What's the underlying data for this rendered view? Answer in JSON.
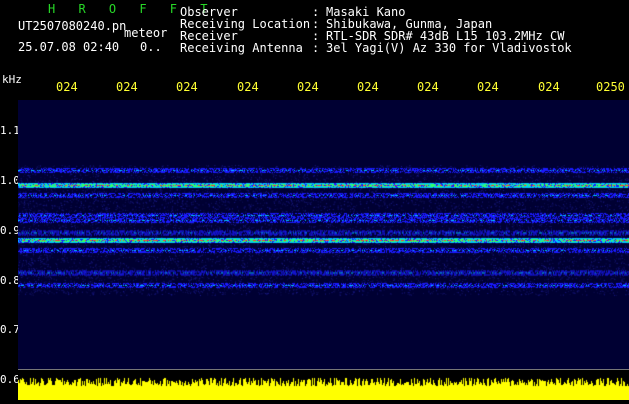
{
  "header": {
    "brand": "H R O F F T",
    "filename": "UT2507080240.pn",
    "file_tag": "meteor",
    "datetime": "25.07.08 02:40",
    "datetime_suffix": "0.."
  },
  "info": [
    {
      "label": "Observer",
      "value": "Masaki Kano"
    },
    {
      "label": "Receiving Location",
      "value": "Shibukawa, Gunma, Japan"
    },
    {
      "label": "Receiver",
      "value": "RTL-SDR SDR# 43dB L15 103.2MHz CW"
    },
    {
      "label": "Receiving Antenna",
      "value": "3el Yagi(V) Az 330 for Vladivostok"
    }
  ],
  "separator": ":",
  "axis": {
    "y_unit": "kHz",
    "time_ticks": [
      "024",
      "024",
      "024",
      "024",
      "024",
      "024",
      "024",
      "024",
      "024",
      "0250"
    ],
    "freq_ticks": [
      "1.1",
      "1.0",
      "0.9",
      "0.8",
      "0.7",
      "0.6"
    ]
  },
  "spectrogram": {
    "background": "#000033",
    "bands_khz": [
      1.02,
      0.99,
      0.97,
      0.93,
      0.92,
      0.895,
      0.88,
      0.86,
      0.815,
      0.79
    ],
    "strong_bands_khz": [
      0.99,
      0.88
    ],
    "colors": {
      "low": "#1a1aff",
      "mid": "#00c8ff",
      "high": "#33ff66",
      "peak": "#ff3333"
    }
  },
  "signal_bar_color": "#ffff00"
}
